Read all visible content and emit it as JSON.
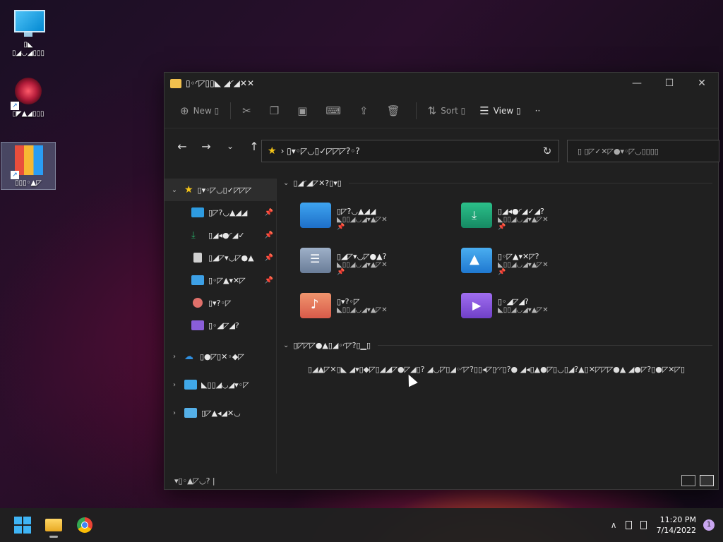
{
  "desktop": {
    "icons": [
      {
        "label": "▯◣\n▯◢◡◢▯▯▯"
      },
      {
        "label": "▯◤▲◢▯▯▯"
      },
      {
        "label": "▯▯▯◦▲◸"
      }
    ]
  },
  "explorer": {
    "title": "▯◦◜◸▯▯◣ ◢◜◢✕✕",
    "window_controls": {
      "minimize": "—",
      "maximize": "☐",
      "close": "✕"
    },
    "toolbar": {
      "new": "New ▯",
      "sort": "Sort ▯",
      "view": "View ▯",
      "more": "··"
    },
    "address": {
      "path": "› ▯▾◦◸◡▯✓◸◸◸?◦?"
    },
    "search": {
      "placeholder": "▯ ▯◸✓✕◸●▾◦◸◡▯▯▯▯"
    },
    "sidebar": {
      "items": [
        {
          "label": "▯▾◦◸◡▯✓◸◸◸",
          "icon": "star-icon",
          "color": "#f5c518"
        },
        {
          "label": "▯◸?◡▲◢◢",
          "icon": "desktop-icon",
          "color": "#2e9be0"
        },
        {
          "label": "▯◢◂●◜◢✓",
          "icon": "download-icon",
          "color": "#29b36b"
        },
        {
          "label": "▯◢◸▾◡◸●▲",
          "icon": "document-icon",
          "color": "#d0d0d0"
        },
        {
          "label": "▯◦◸▲▾✕◸",
          "icon": "picture-icon",
          "color": "#3da0e6"
        },
        {
          "label": "▯▾?◦◸",
          "icon": "music-icon",
          "color": "#e0706a"
        },
        {
          "label": "▯◦◢◸◢?",
          "icon": "video-icon",
          "color": "#8a5ed8"
        },
        {
          "label": "▯●◸▯✕◦◆◸",
          "icon": "onedrive-icon",
          "color": "#2f8fe0"
        },
        {
          "label": "◣▯▯◢◡◢▾◦◸",
          "icon": "this-pc-icon",
          "color": "#40a8e8"
        },
        {
          "label": "▯◸▲◂◢✕◡",
          "icon": "network-icon",
          "color": "#55b0e8"
        }
      ]
    },
    "quick_access": {
      "header": "▯◢◜◢◸✕?▯▾▯",
      "tiles": [
        {
          "name": "▯◸?◡▲◢◢",
          "sub": "◣▯▯◢◡◢▾▲◸✕",
          "color": "#2e8fe0"
        },
        {
          "name": "▯◢◂●◜◢✓◢?",
          "sub": "◣▯▯◢◡◢▾▲◸✕",
          "color": "#21a57a"
        },
        {
          "name": "▯◢◸▾◡◸●▲?",
          "sub": "◣▯▯◢◡◢▾▲◸✕",
          "color": "#7d8ea8"
        },
        {
          "name": "▯◦◸▲▾✕◸?",
          "sub": "◣▯▯◢◡◢▾▲◸✕",
          "color": "#3a94e0"
        },
        {
          "name": "▯▾?◦◸",
          "sub": "◣▯▯◢◡◢▾▲◸✕",
          "color": "#e07a5f"
        },
        {
          "name": "▯◦◢◸◢?",
          "sub": "◣▯▯◢◡◢▾▲◸✕",
          "color": "#8e5ae0"
        }
      ]
    },
    "recent": {
      "header": "▯◸◸◸●▲▯◢◦◜◸?▯▁▯",
      "message": "▯◢▲◸✕▯◣ ◢▾▯◆◸▯◢◢◸●◸◢▯? ◢◡◸▯◢◦◜◸?▯▯◂◸▯◜◜▯?● ◢◂▯▲●◸▯◡▯◢?▲▯✕◸◸◸●▲ ◢●◸?▯●◸✕◸▯"
    },
    "status": {
      "items": "▾▯◦▲◸◡? |"
    }
  },
  "taskbar": {
    "time": "11:20 PM",
    "date": "7/14/2022",
    "notifications": "1"
  }
}
